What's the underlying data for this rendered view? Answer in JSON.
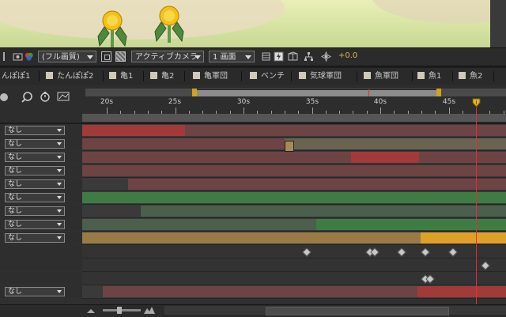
{
  "viewer": {
    "magnification": "(フル画質)",
    "camera": "アクティブカメラ",
    "views": "1 画面",
    "exposure": "+0.0"
  },
  "tabs": [
    "んぽぽ1",
    "たんぽぽ2",
    "亀1",
    "亀2",
    "亀軍団",
    "ベンチ",
    "気球軍団",
    "魚軍団",
    "魚1",
    "魚2"
  ],
  "ruler": {
    "labels": [
      "20s",
      "25s",
      "30s",
      "35s",
      "40s",
      "45s"
    ]
  },
  "layers": {
    "parent_label": "なし"
  },
  "colors": {
    "red_layer": "#a33a3a",
    "red_dim": "#6e4343",
    "green_layer": "#3e7c44",
    "green_dim": "#4c5f4c",
    "orange_layer": "#e0a028",
    "tan_layer": "#9a7b45",
    "playhead": "#e33030",
    "work_area": "#d4a318"
  }
}
